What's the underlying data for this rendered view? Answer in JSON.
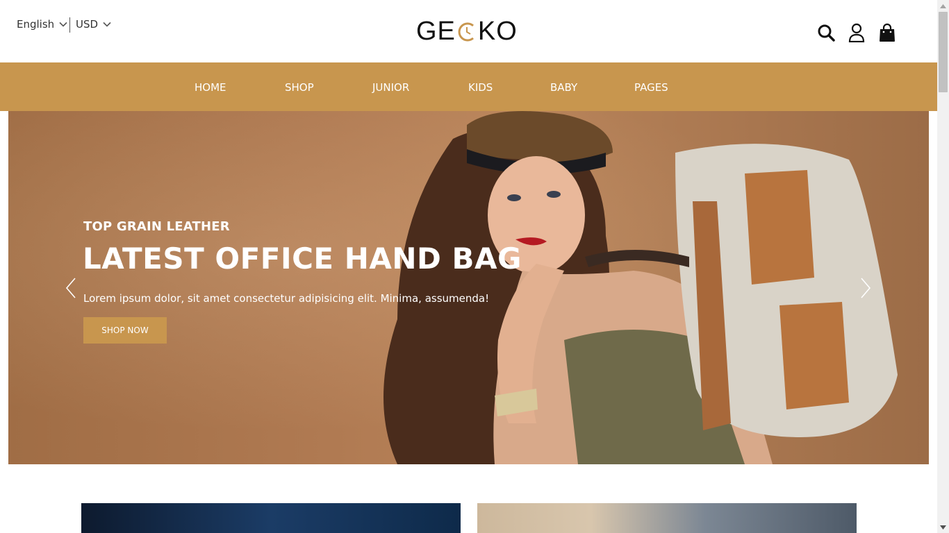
{
  "header": {
    "language": "English",
    "currency": "USD",
    "logo_left": "GE",
    "logo_right": "KO",
    "icons": [
      "search-icon",
      "user-icon",
      "shopping-bag-icon"
    ]
  },
  "nav": {
    "items": [
      "HOME",
      "SHOP",
      "JUNIOR",
      "KIDS",
      "BABY",
      "PAGES"
    ]
  },
  "hero": {
    "subtitle": "TOP GRAIN LEATHER",
    "title": "LATEST OFFICE HAND BAG",
    "description": "Lorem ipsum dolor, sit amet consectetur adipisicing elit. Minima, assumenda!",
    "button": "SHOP NOW"
  },
  "colors": {
    "accent": "#c8964e",
    "hero_bg": "#b07a52",
    "text_dark": "#222222",
    "white": "#ffffff"
  }
}
